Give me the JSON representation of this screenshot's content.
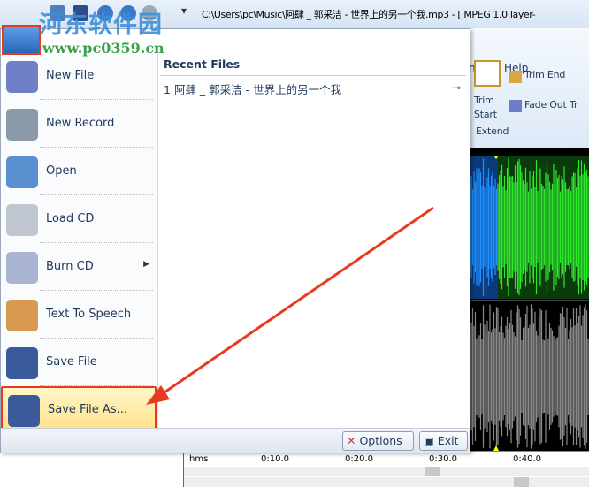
{
  "title": "C:\\Users\\pc\\Music\\阿肆 _ 郭采洁 - 世界上的另一个我.mp3 - [ MPEG 1.0 layer-",
  "watermark": {
    "name": "河东软件园",
    "url": "www.pc0359.cn"
  },
  "ribbon": {
    "tabs": [
      "ns",
      "Help"
    ],
    "trim_start": "Trim Start",
    "extend": "Extend",
    "trim_end": "Trim End",
    "fade_out": "Fade Out Tr"
  },
  "menu": {
    "items": [
      {
        "label": "New File",
        "icon": "new-file-icon"
      },
      {
        "label": "New Record",
        "icon": "microphone-icon"
      },
      {
        "label": "Open",
        "icon": "open-folder-icon"
      },
      {
        "label": "Load CD",
        "icon": "cd-drive-icon"
      },
      {
        "label": "Burn CD",
        "icon": "burn-cd-icon",
        "submenu": true
      },
      {
        "label": "Text To Speech",
        "icon": "speech-person-icon"
      },
      {
        "label": "Save File",
        "icon": "save-icon"
      },
      {
        "label": "Save File As...",
        "icon": "save-as-icon",
        "highlighted": true
      }
    ],
    "recent_header": "Recent Files",
    "recent_files": [
      {
        "index": "1",
        "name": "阿肆 _ 郭采洁 - 世界上的另一个我"
      }
    ],
    "options": "Options",
    "exit": "Exit"
  },
  "timeline": {
    "unit": "hms",
    "ticks": [
      "0:10.0",
      "0:20.0",
      "0:30.0",
      "0:40.0"
    ]
  },
  "colors": {
    "highlight_border": "#e83a1f",
    "wave_selected": "#1e90ff",
    "wave_green": "#2ee82e",
    "wave_gray": "#8a8a8a"
  }
}
